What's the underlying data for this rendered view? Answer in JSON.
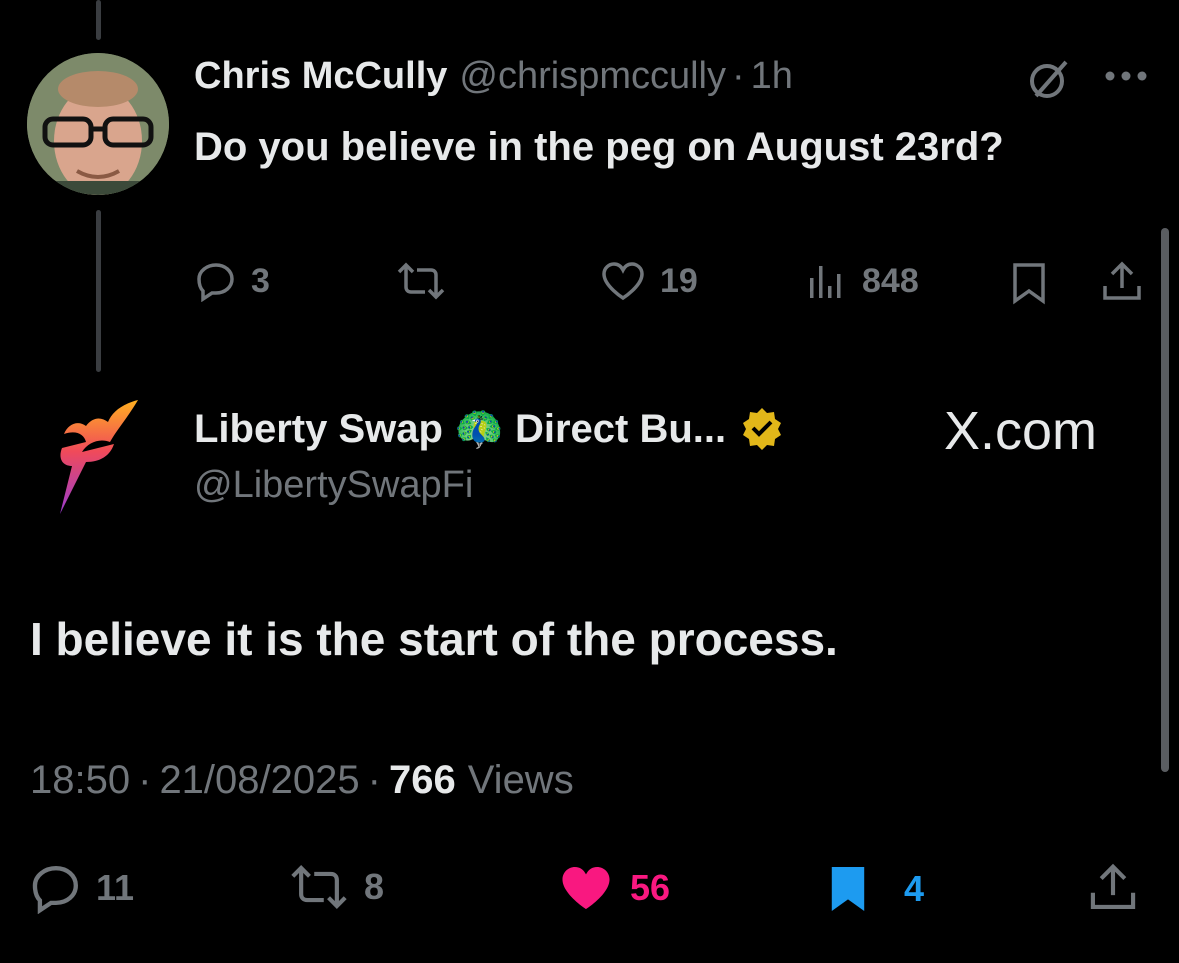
{
  "parent": {
    "name": "Chris McCully",
    "handle": "@chrispmccully",
    "sep": "·",
    "time": "1h",
    "text": "Do you believe in the peg on August 23rd?",
    "actions": {
      "replies": "3",
      "reposts": "",
      "likes": "19",
      "views": "848"
    }
  },
  "reply": {
    "name": "Liberty Swap 🦚 Direct Bu...",
    "handle": "@LibertySwapFi",
    "source": "X.com",
    "text": "I believe it is the start of the process.",
    "time": "18:50",
    "sep1": "·",
    "date": "21/08/2025",
    "sep2": "·",
    "views_count": "766",
    "views_label": "Views",
    "actions": {
      "replies": "11",
      "reposts": "8",
      "likes": "56",
      "bookmarks": "4"
    }
  },
  "colors": {
    "like": "#f91880",
    "bookmark": "#1d9bf0",
    "verified": "#e2b719",
    "muted": "#71767b"
  },
  "icons": [
    "reply-icon",
    "repost-icon",
    "like-icon",
    "views-icon",
    "bookmark-icon",
    "share-icon",
    "grok-icon",
    "more-icon",
    "verified-badge-icon",
    "liberty-swap-logo",
    "avatar"
  ]
}
